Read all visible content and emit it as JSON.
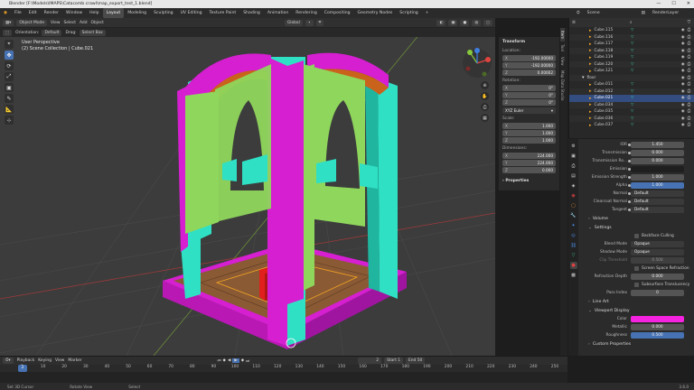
{
  "window": {
    "title": "Blender [F:\\Models\\IMAPS\\Catacomb crawl\\map_export_test_1.blend]",
    "minimize": "—",
    "maximize": "☐",
    "close": "✕"
  },
  "menubar": {
    "menus": [
      "File",
      "Edit",
      "Render",
      "Window",
      "Help"
    ],
    "workspaces": [
      "Layout",
      "Modeling",
      "Sculpting",
      "UV Editing",
      "Texture Paint",
      "Shading",
      "Animation",
      "Rendering",
      "Compositing",
      "Geometry Nodes",
      "Scripting"
    ],
    "active_workspace": "Layout",
    "scene_label": "Scene",
    "view_layer_label": "RenderLayer"
  },
  "viewport_header": {
    "mode": "Object Mode",
    "menus": [
      "View",
      "Select",
      "Add",
      "Object"
    ],
    "transform_orientation": "Global",
    "pivot": "∙",
    "snap": "⌗"
  },
  "viewport_header2": {
    "orientation_label": "Orientation:",
    "orientation_value": "Default",
    "drag_label": "Drag:",
    "drag_value": "Select Box"
  },
  "viewport_info": {
    "line1": "User Perspective",
    "line2": "(2) Scene Collection | Cube.021"
  },
  "tools": [
    "⌖",
    "✥",
    "⟳",
    "⤢",
    "▣",
    "✎",
    "📐",
    "⊹"
  ],
  "npanel": {
    "title": "Transform",
    "location_label": "Location:",
    "location": [
      {
        "k": "X",
        "v": "-192.00000"
      },
      {
        "k": "Y",
        "v": "-192.00000"
      },
      {
        "k": "Z",
        "v": "0.00002"
      }
    ],
    "rotation_label": "Rotation:",
    "rotation": [
      {
        "k": "X",
        "v": "0°"
      },
      {
        "k": "Y",
        "v": "0°"
      },
      {
        "k": "Z",
        "v": "0°"
      }
    ],
    "rotation_mode": "XYZ Euler",
    "scale_label": "Scale:",
    "scale": [
      {
        "k": "X",
        "v": "1.000"
      },
      {
        "k": "Y",
        "v": "1.000"
      },
      {
        "k": "Z",
        "v": "1.000"
      }
    ],
    "dimensions_label": "Dimensions:",
    "dimensions": [
      {
        "k": "X",
        "v": "224.000"
      },
      {
        "k": "Y",
        "v": "224.000"
      },
      {
        "k": "Z",
        "v": "0.000"
      }
    ],
    "properties_label": "Properties"
  },
  "sidetabs": [
    "Item",
    "Tool",
    "View",
    "Map Data Studio"
  ],
  "outliner": {
    "rows": [
      {
        "name": "Cube.115",
        "indent": 0
      },
      {
        "name": "Cube.116",
        "indent": 0
      },
      {
        "name": "Cube.117",
        "indent": 0
      },
      {
        "name": "Cube.118",
        "indent": 0
      },
      {
        "name": "Cube.119",
        "indent": 0
      },
      {
        "name": "Cube.120",
        "indent": 0
      },
      {
        "name": "Cube.121",
        "indent": 0
      },
      {
        "name": "floor",
        "indent": -1
      },
      {
        "name": "Cube.011",
        "indent": 0
      },
      {
        "name": "Cube.012",
        "indent": 0
      },
      {
        "name": "Cube.021",
        "indent": 0,
        "selected": true
      },
      {
        "name": "Cube.034",
        "indent": 0
      },
      {
        "name": "Cube.035",
        "indent": 0
      },
      {
        "name": "Cube.036",
        "indent": 0
      },
      {
        "name": "Cube.037",
        "indent": 0
      }
    ]
  },
  "properties": {
    "rows1": [
      {
        "label": "IOR",
        "value": "1.450",
        "style": ""
      },
      {
        "label": "Transmission",
        "value": "0.000",
        "style": ""
      },
      {
        "label": "Transmission Ro...",
        "value": "0.000",
        "style": ""
      },
      {
        "label": "Emission",
        "value": "",
        "style": "dark"
      },
      {
        "label": "Emission Strength",
        "value": "1.000",
        "style": ""
      },
      {
        "label": "Alpha",
        "value": "1.000",
        "style": "blue"
      },
      {
        "label": "Normal",
        "value": "Default",
        "style": "sel"
      },
      {
        "label": "Clearcoat Normal",
        "value": "Default",
        "style": "sel"
      },
      {
        "label": "Tangent",
        "value": "Default",
        "style": "sel"
      }
    ],
    "volume_label": "Volume",
    "settings_label": "Settings",
    "backface_label": "Backface Culling",
    "rows2": [
      {
        "label": "Blend Mode",
        "value": "Opaque"
      },
      {
        "label": "Shadow Mode",
        "value": "Opaque"
      },
      {
        "label": "Clip Threshold",
        "value": "0.500"
      }
    ],
    "ssr_label": "Screen Space Refraction",
    "refraction_label": "Refraction Depth",
    "refraction_value": "0.000",
    "subsurface_label": "Subsurface Translucency",
    "pass_label": "Pass Index",
    "pass_value": "0",
    "lineart_label": "Line Art",
    "viewport_display_label": "Viewport Display",
    "color_label": "Color",
    "color_value": "#f522e0",
    "metallic_label": "Metallic",
    "metallic_value": "0.000",
    "roughness_label": "Roughness",
    "roughness_value": "0.500",
    "custom_props_label": "Custom Properties"
  },
  "timeline": {
    "menus": [
      "Playback",
      "Keying",
      "View",
      "Marker"
    ],
    "current_frame": "2",
    "start_label": "Start",
    "start": "1",
    "end_label": "End",
    "end": "50",
    "ticks": [
      "0",
      "10",
      "20",
      "30",
      "40",
      "50",
      "60",
      "70",
      "80",
      "90",
      "100",
      "110",
      "120",
      "130",
      "140",
      "150",
      "160",
      "170",
      "180",
      "190",
      "200",
      "210",
      "220",
      "230",
      "240",
      "250"
    ],
    "playhead": "2"
  },
  "status": {
    "select": "Set 3D Cursor",
    "rotate": "Rotate View",
    "menu": "Select",
    "version": "3.6.0"
  },
  "colors": {
    "magenta": "#f21ee8",
    "green": "#8fd65c",
    "cyan": "#2fe0c4",
    "brown": "#8a5a34",
    "orange": "#c9621a",
    "red": "#e0201c",
    "accent": "#4772b3"
  }
}
